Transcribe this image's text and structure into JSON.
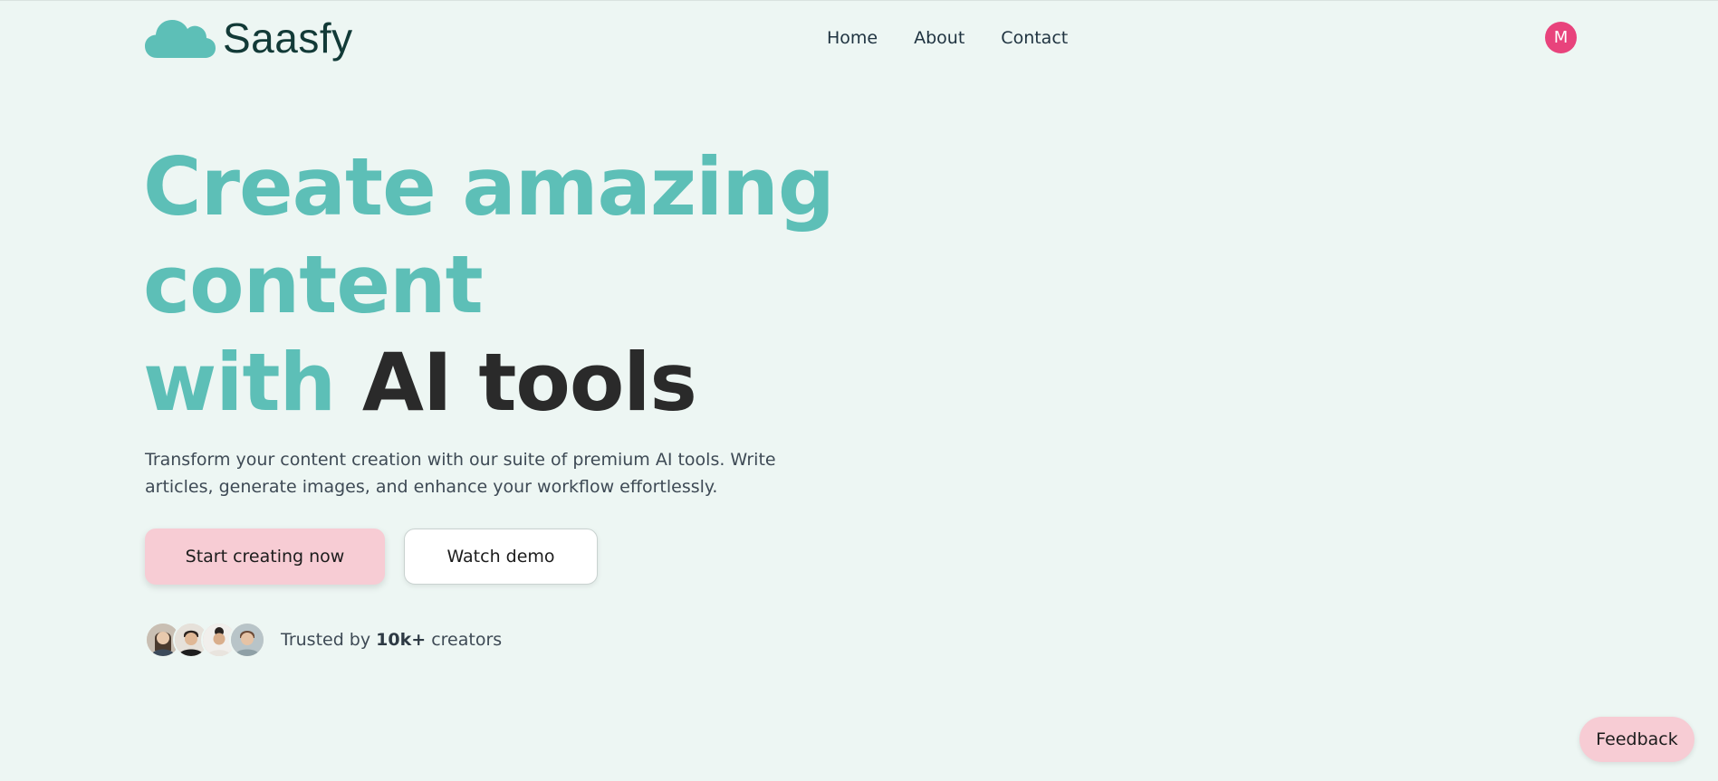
{
  "brand": {
    "name": "Saasfy",
    "logo_icon": "cloud-icon",
    "accent_color": "#5dbfb7",
    "pink_color": "#f7ccd4"
  },
  "nav": {
    "links": [
      "Home",
      "About",
      "Contact"
    ]
  },
  "user": {
    "initial": "M",
    "avatar_color": "#e8437c"
  },
  "hero": {
    "title_line1": "Create amazing",
    "title_line2": "content",
    "title_line3_accent": "with",
    "title_line3_dark": "AI tools",
    "subtitle": "Transform your content creation with our suite of premium AI tools. Write articles, generate images, and enhance your workflow effortlessly.",
    "primary_cta": "Start creating now",
    "secondary_cta": "Watch demo"
  },
  "social_proof": {
    "prefix": "Trusted by",
    "count": "10k+",
    "suffix": "creators"
  },
  "feedback_button": "Feedback"
}
